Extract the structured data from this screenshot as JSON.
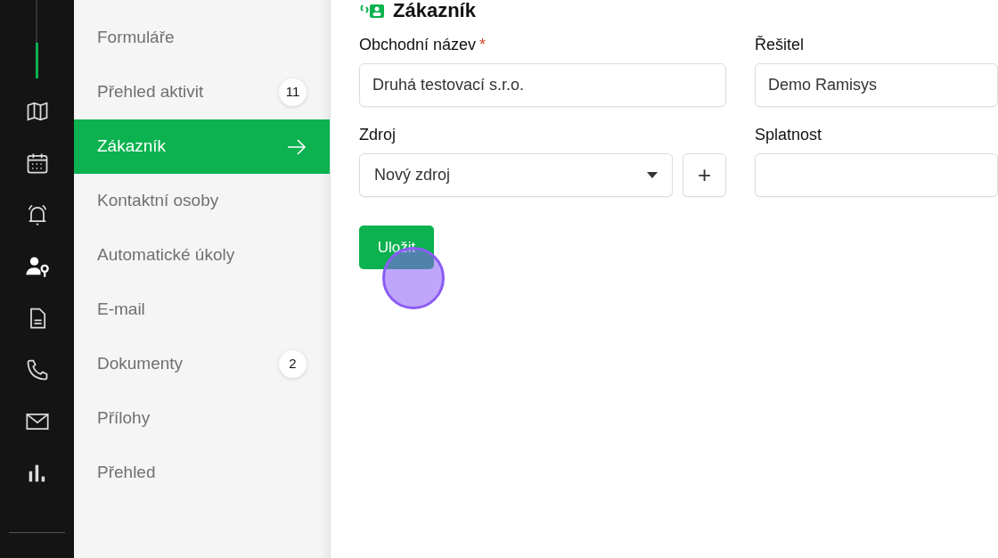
{
  "rail": {
    "items": [
      {
        "kind": "map",
        "selected": false
      },
      {
        "kind": "calendar",
        "selected": false
      },
      {
        "kind": "alarm",
        "selected": false
      },
      {
        "kind": "user-key",
        "selected": true
      },
      {
        "kind": "document",
        "selected": false
      },
      {
        "kind": "phone",
        "selected": false
      },
      {
        "kind": "mail",
        "selected": false
      },
      {
        "kind": "chart",
        "selected": false
      }
    ]
  },
  "submenu": {
    "items": [
      {
        "label": "Formuláře",
        "selected": false
      },
      {
        "label": "Přehled aktivit",
        "selected": false,
        "badge": "11"
      },
      {
        "label": "Zákazník",
        "selected": true
      },
      {
        "label": "Kontaktní osoby",
        "selected": false
      },
      {
        "label": "Automatické úkoly",
        "selected": false
      },
      {
        "label": "E-mail",
        "selected": false
      },
      {
        "label": "Dokumenty",
        "selected": false,
        "badge": "2"
      },
      {
        "label": "Přílohy",
        "selected": false
      },
      {
        "label": "Přehled",
        "selected": false
      }
    ]
  },
  "form": {
    "title": "Zákazník",
    "fields": [
      {
        "kind": "text",
        "label": "Obchodní název",
        "required_mark": "*",
        "value": "Druhá testovací s.r.o."
      },
      {
        "kind": "text",
        "label": "Řešitel",
        "value": "Demo Ramisys"
      },
      {
        "kind": "select",
        "label": "Zdroj",
        "value": "Nový zdroj",
        "add_button": "+"
      },
      {
        "kind": "text",
        "label": "Splatnost"
      }
    ],
    "save_button": "Uložit"
  }
}
